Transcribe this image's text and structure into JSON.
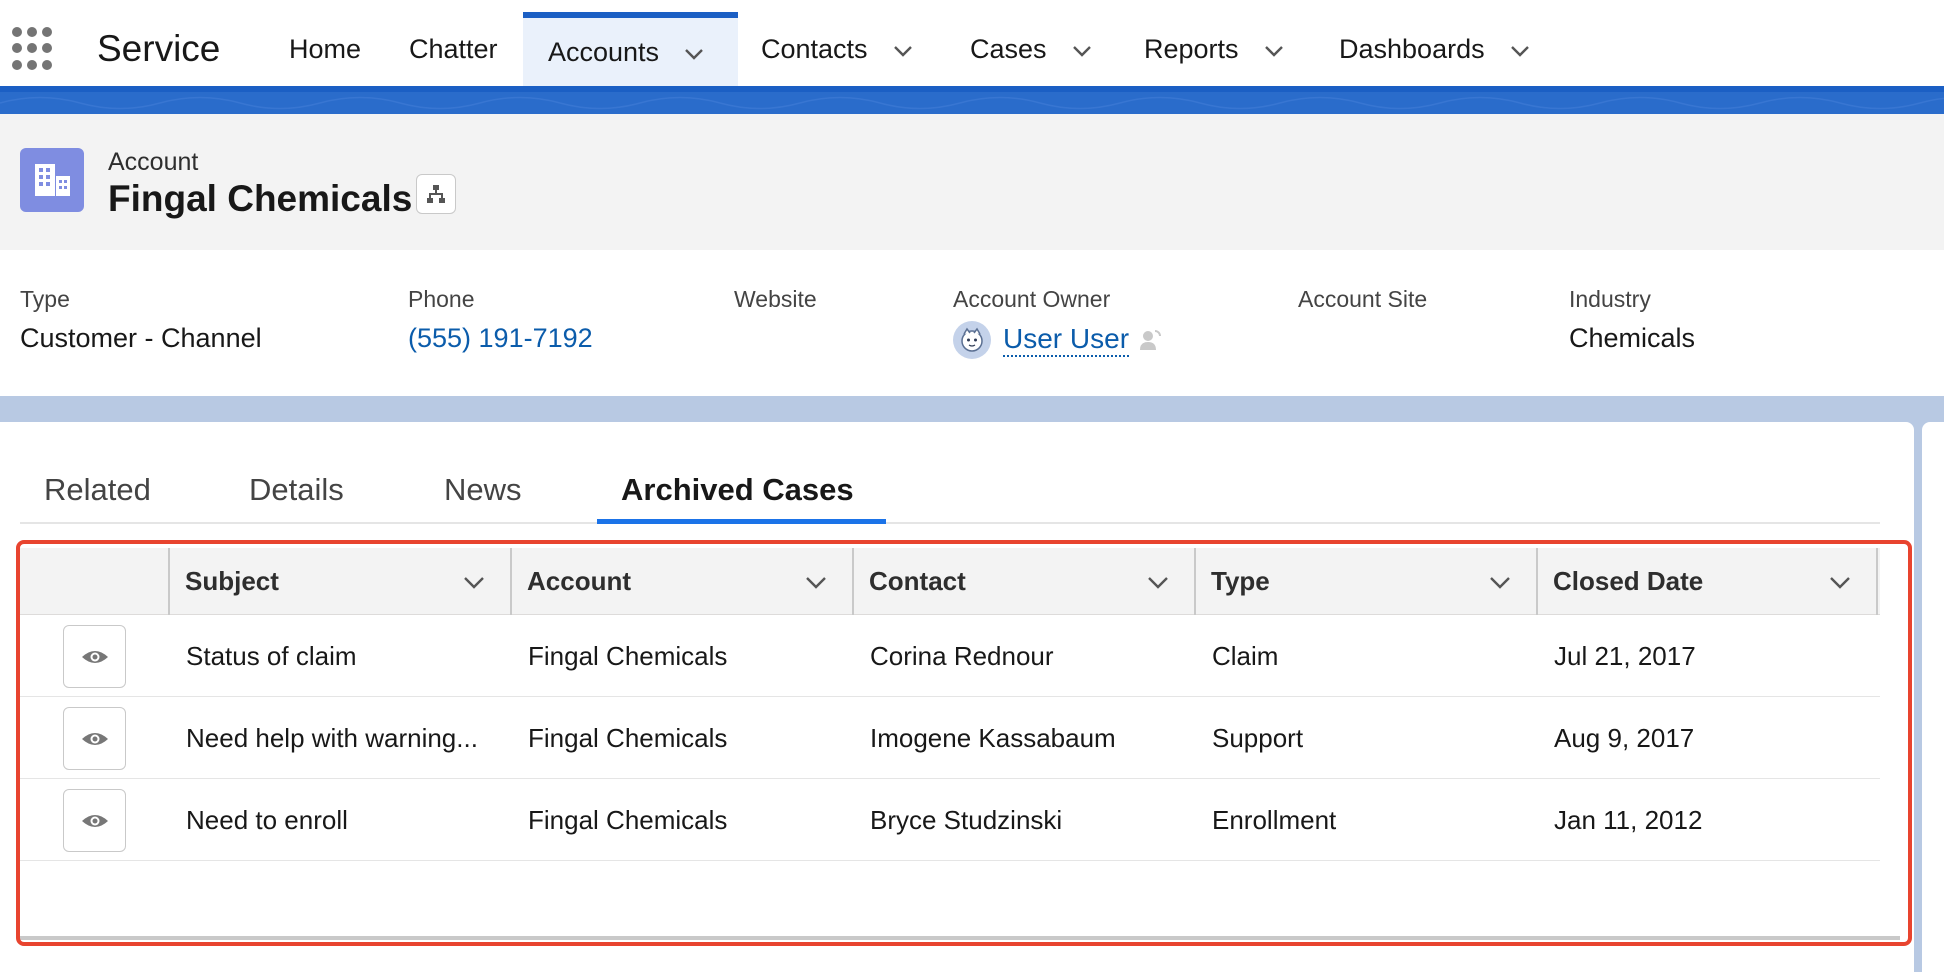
{
  "nav": {
    "app_name": "Service",
    "items": [
      {
        "label": "Home",
        "has_menu": false
      },
      {
        "label": "Chatter",
        "has_menu": false
      },
      {
        "label": "Accounts",
        "has_menu": true,
        "active": true
      },
      {
        "label": "Contacts",
        "has_menu": true
      },
      {
        "label": "Cases",
        "has_menu": true
      },
      {
        "label": "Reports",
        "has_menu": true
      },
      {
        "label": "Dashboards",
        "has_menu": true
      }
    ]
  },
  "record": {
    "object_label": "Account",
    "name": "Fingal Chemicals",
    "icon": "account-building-icon",
    "icon_color": "#7f8de1"
  },
  "highlights": {
    "type_label": "Type",
    "type_value": "Customer - Channel",
    "phone_label": "Phone",
    "phone_value": "(555) 191-7192",
    "website_label": "Website",
    "website_value": "",
    "owner_label": "Account Owner",
    "owner_value": "User User",
    "site_label": "Account Site",
    "site_value": "",
    "industry_label": "Industry",
    "industry_value": "Chemicals"
  },
  "tabs": [
    {
      "label": "Related"
    },
    {
      "label": "Details"
    },
    {
      "label": "News"
    },
    {
      "label": "Archived Cases",
      "active": true
    }
  ],
  "table": {
    "columns": [
      "Subject",
      "Account",
      "Contact",
      "Type",
      "Closed Date"
    ],
    "rows": [
      {
        "subject": "Status of claim",
        "account": "Fingal Chemicals",
        "contact": "Corina Rednour",
        "type": "Claim",
        "closed_date": "Jul 21, 2017"
      },
      {
        "subject": "Need help with warning...",
        "account": "Fingal Chemicals",
        "contact": "Imogene Kassabaum",
        "type": "Support",
        "closed_date": "Aug 9, 2017"
      },
      {
        "subject": "Need to enroll",
        "account": "Fingal Chemicals",
        "contact": "Bryce Studzinski",
        "type": "Enrollment",
        "closed_date": "Jan 11, 2012"
      }
    ]
  },
  "colors": {
    "brand": "#1b5fc4",
    "link": "#0b5cab",
    "highlight_border": "#e8442f"
  }
}
